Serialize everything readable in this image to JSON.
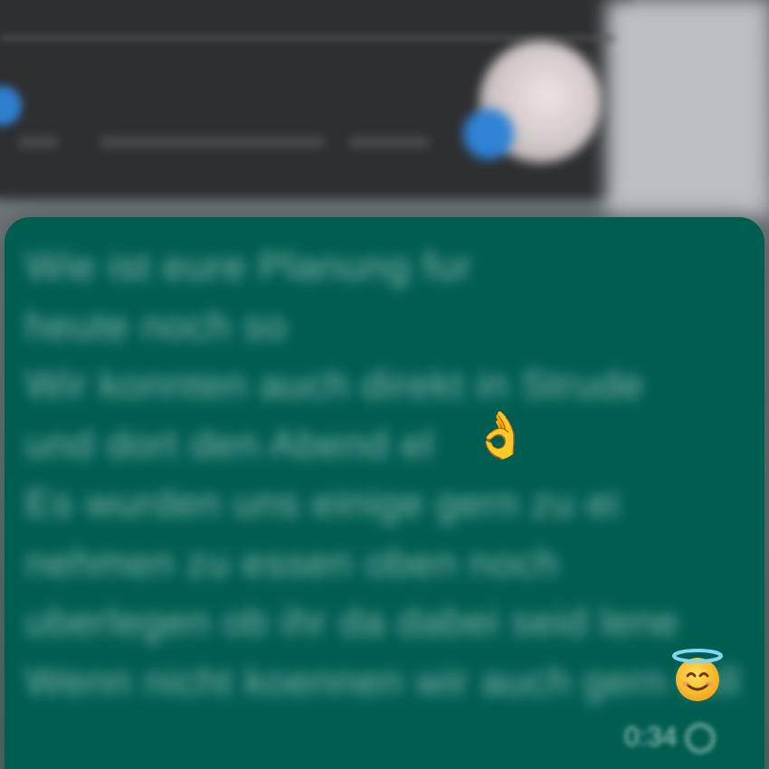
{
  "message": {
    "lines": [
      "Wie ist eure Planung fur",
      "heute noch so",
      "Wir konnten auch direkt in Strude",
      "und dort den Abend el",
      "Es wurden uns einige gern zu ei",
      "nehmen zu essen oben noch",
      "uberlegen ob ihr da dabei seid lene",
      "Wenn nicht koennen wir auch gern still"
    ],
    "emoji_1": "ok-hand-emoji",
    "emoji_2": "smiling-face-with-halo-emoji",
    "time": "0:34"
  },
  "colors": {
    "bubble": "#005e51",
    "background_bar": "#2e2f31",
    "accent_blue": "#2f82d6"
  }
}
